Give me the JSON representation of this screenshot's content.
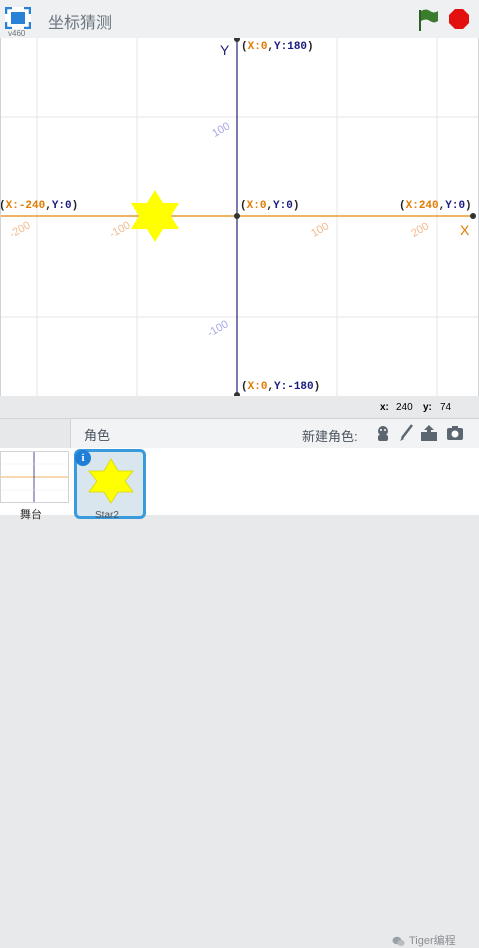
{
  "header": {
    "version": "v460",
    "title": "坐标猜测",
    "fullscreen_icon": "fullscreen-icon",
    "green_flag_icon": "green-flag-icon",
    "stop_icon": "stop-icon",
    "colors": {
      "flag": "#3b7d2e",
      "stop": "#e2110f"
    }
  },
  "stage": {
    "axis_names": {
      "y": "Y",
      "x": "X"
    },
    "labels": {
      "top": {
        "x": "0",
        "y": "180"
      },
      "center": {
        "x": "0",
        "y": "0"
      },
      "left": {
        "x": "-240",
        "y": "0"
      },
      "right": {
        "x": "240",
        "y": "0"
      },
      "bottom": {
        "x": "0",
        "y": "-180"
      }
    },
    "ticks": {
      "x_neg": "-200",
      "x_neg2": "-100",
      "x_pos": "100",
      "x_pos2": "200",
      "y_pos": "100",
      "y_neg": "-100"
    },
    "star_color": "#ffff00",
    "axis_colors": {
      "x": "#e69a2e",
      "y": "#23237a"
    }
  },
  "mouse_readout": {
    "x_label": "x:",
    "x_value": "240",
    "y_label": "y:",
    "y_value": "74"
  },
  "sprite_panel": {
    "title": "角色",
    "new_sprite_label": "新建角色:",
    "new_sprite_icons": [
      "sprite-library-icon",
      "paint-brush-icon",
      "upload-icon",
      "camera-icon"
    ],
    "stage_thumb_name": "舞台",
    "sprite_name": "Star2"
  },
  "watermark": {
    "text": "Tiger编程"
  }
}
